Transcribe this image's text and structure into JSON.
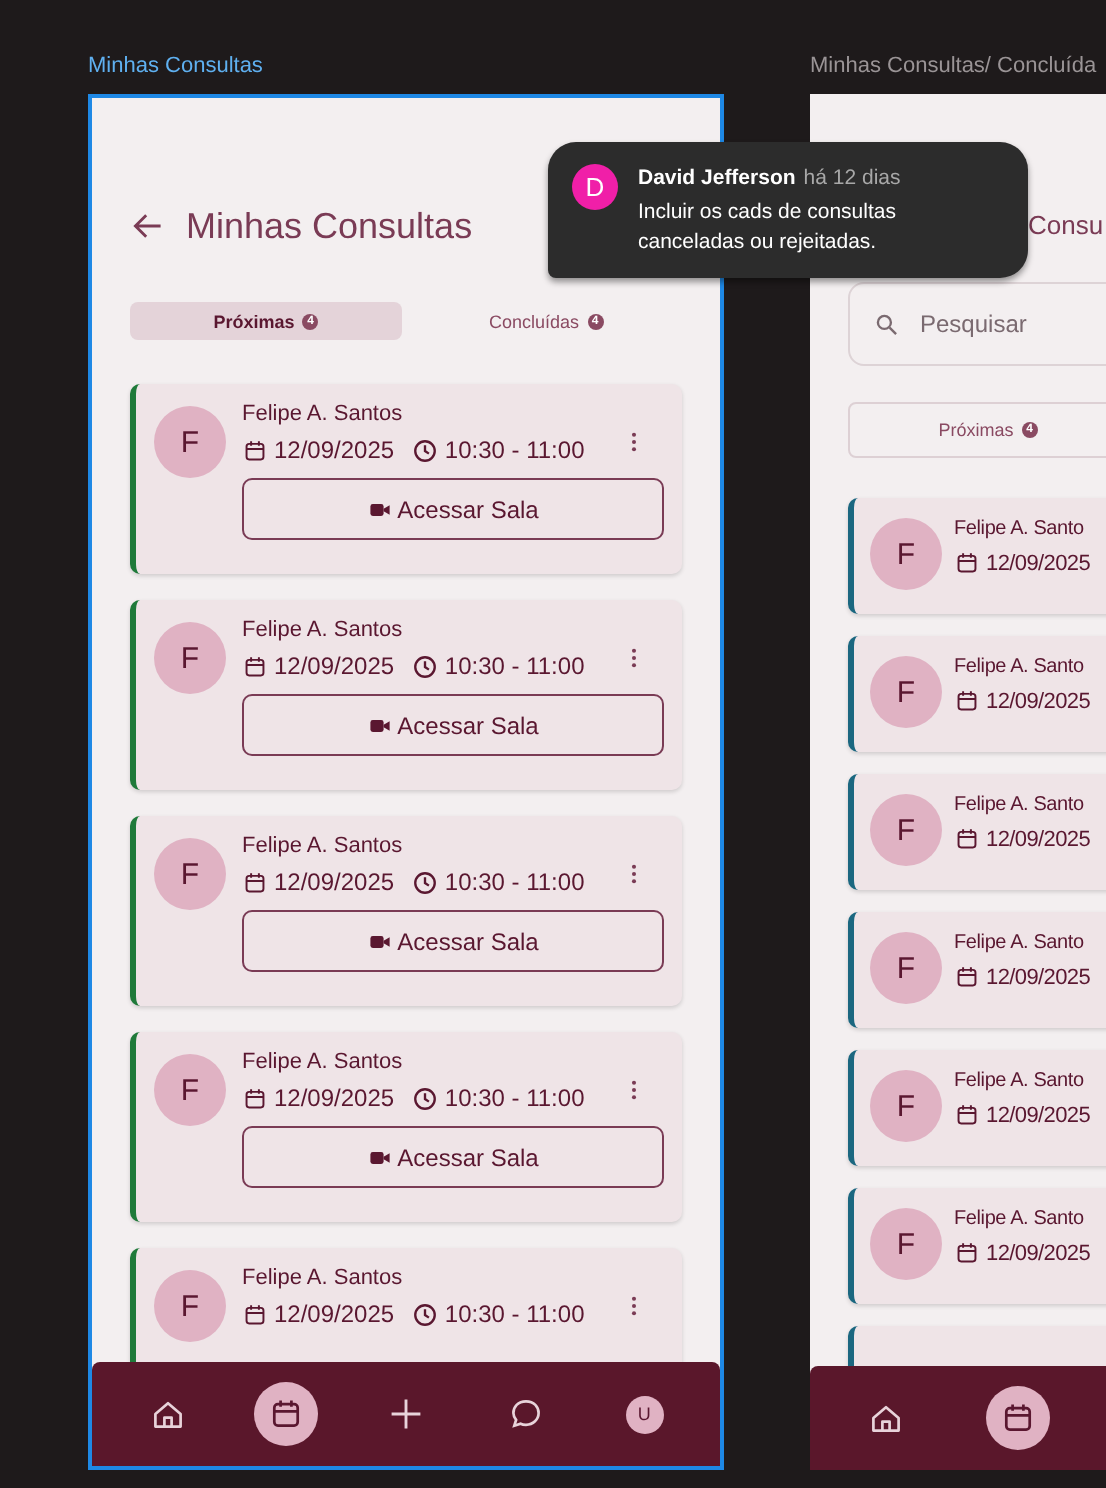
{
  "frames": [
    {
      "kind": "list",
      "label": "Minhas Consultas",
      "selected": true,
      "title": "Minhas Consultas",
      "tabs": [
        {
          "label": "Próximas",
          "count": "4",
          "selected": true
        },
        {
          "label": "Concluídas",
          "count": "4",
          "selected": false
        }
      ],
      "cards": [
        {
          "avatar": "F",
          "name": "Felipe A. Santos",
          "date": "12/09/2025",
          "time": "10:30 - 11:00",
          "button": "Acessar Sala",
          "color": "#1f7a3a"
        },
        {
          "avatar": "F",
          "name": "Felipe A. Santos",
          "date": "12/09/2025",
          "time": "10:30 - 11:00",
          "button": "Acessar Sala",
          "color": "#1f7a3a"
        },
        {
          "avatar": "F",
          "name": "Felipe A. Santos",
          "date": "12/09/2025",
          "time": "10:30 - 11:00",
          "button": "Acessar Sala",
          "color": "#1f7a3a"
        },
        {
          "avatar": "F",
          "name": "Felipe A. Santos",
          "date": "12/09/2025",
          "time": "10:30 - 11:00",
          "button": "Acessar Sala",
          "color": "#1f7a3a"
        },
        {
          "avatar": "F",
          "name": "Felipe A. Santos",
          "date": "12/09/2025",
          "time": "10:30 - 11:00",
          "color": "#1f7a3a"
        }
      ],
      "nav": [
        {
          "kind": "home",
          "selected": false
        },
        {
          "kind": "calendar",
          "selected": true
        },
        {
          "kind": "plus",
          "selected": false
        },
        {
          "kind": "chat",
          "selected": false
        },
        {
          "kind": "avatar",
          "text": "U",
          "selected": false
        }
      ]
    },
    {
      "kind": "search",
      "label": "Minhas Consultas/ Concluída",
      "selected": false,
      "title": "Consu",
      "search": {
        "placeholder": "Pesquisar"
      },
      "tabs": [
        {
          "label": "Próximas",
          "count": "4",
          "selected": false
        }
      ],
      "cards": [
        {
          "avatar": "F",
          "name": "Felipe A. Santo",
          "date": "12/09/2025",
          "color": "#1b6780"
        },
        {
          "avatar": "F",
          "name": "Felipe A. Santo",
          "date": "12/09/2025",
          "color": "#1b6780"
        },
        {
          "avatar": "F",
          "name": "Felipe A. Santo",
          "date": "12/09/2025",
          "color": "#1b6780"
        },
        {
          "avatar": "F",
          "name": "Felipe A. Santo",
          "date": "12/09/2025",
          "color": "#1b6780"
        },
        {
          "avatar": "F",
          "name": "Felipe A. Santo",
          "date": "12/09/2025",
          "color": "#1b6780"
        },
        {
          "avatar": "F",
          "name": "Felipe A. Santo",
          "date": "12/09/2025",
          "color": "#1b6780"
        },
        {
          "color": "#1b6780"
        }
      ],
      "nav": [
        {
          "kind": "home",
          "selected": false
        },
        {
          "kind": "calendar",
          "selected": true
        }
      ]
    }
  ],
  "comment": {
    "avatar": "D",
    "author": "David Jefferson",
    "time": "há 12 dias",
    "text": "Incluir os cads de consultas canceladas ou rejeitadas."
  }
}
